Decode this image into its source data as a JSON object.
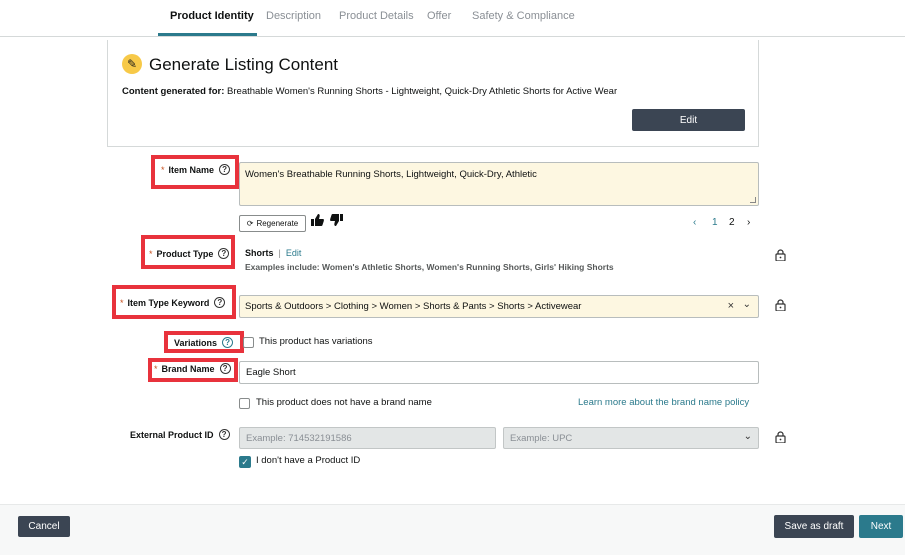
{
  "tabs": [
    {
      "label": "Product Identity",
      "active": true
    },
    {
      "label": "Description",
      "active": false
    },
    {
      "label": "Product Details",
      "active": false
    },
    {
      "label": "Offer",
      "active": false
    },
    {
      "label": "Safety & Compliance",
      "active": false
    }
  ],
  "generate": {
    "icon": "magic-wand-icon",
    "title": "Generate Listing Content",
    "content_for_label": "Content generated for:",
    "content_for_value": "Breathable Women's Running Shorts - Lightweight, Quick-Dry Athletic Shorts for Active Wear",
    "edit_label": "Edit"
  },
  "required_mark": "*",
  "help_mark": "?",
  "item_name": {
    "label": "Item Name",
    "value": "Women's Breathable Running Shorts, Lightweight, Quick-Dry, Athletic",
    "regenerate_label": "Regenerate",
    "pager": {
      "prev": "‹",
      "page1": "1",
      "page2": "2",
      "next": "›"
    }
  },
  "product_type": {
    "label": "Product Type",
    "value": "Shorts",
    "separator": "|",
    "edit_label": "Edit",
    "examples": "Examples include: Women's Athletic Shorts, Women's Running Shorts, Girls' Hiking Shorts"
  },
  "item_type_keyword": {
    "label": "Item Type Keyword",
    "value": "Sports & Outdoors > Clothing > Women > Shorts & Pants > Shorts > Activewear",
    "clear": "×",
    "chevron": "⌄"
  },
  "variations": {
    "label": "Variations",
    "checkbox_label": "This product has variations",
    "checked": false
  },
  "brand_name": {
    "label": "Brand Name",
    "value": "Eagle Short",
    "no_brand_label": "This product does not have a brand name",
    "no_brand_checked": false,
    "learn_more": "Learn more about the brand name policy"
  },
  "external_product_id": {
    "label": "External Product ID",
    "id_placeholder": "Example: 714532191586",
    "type_placeholder": "Example: UPC",
    "chevron": "⌄",
    "no_id_label": "I don't have a Product ID",
    "no_id_checked": true,
    "check_mark": "✓"
  },
  "footer": {
    "cancel": "Cancel",
    "save_draft": "Save as draft",
    "next": "Next"
  },
  "colors": {
    "accent": "#2b7a8c",
    "dark_button": "#3b4553",
    "highlight_box": "#e8323c",
    "filled_field_bg": "#fdf7e1"
  }
}
